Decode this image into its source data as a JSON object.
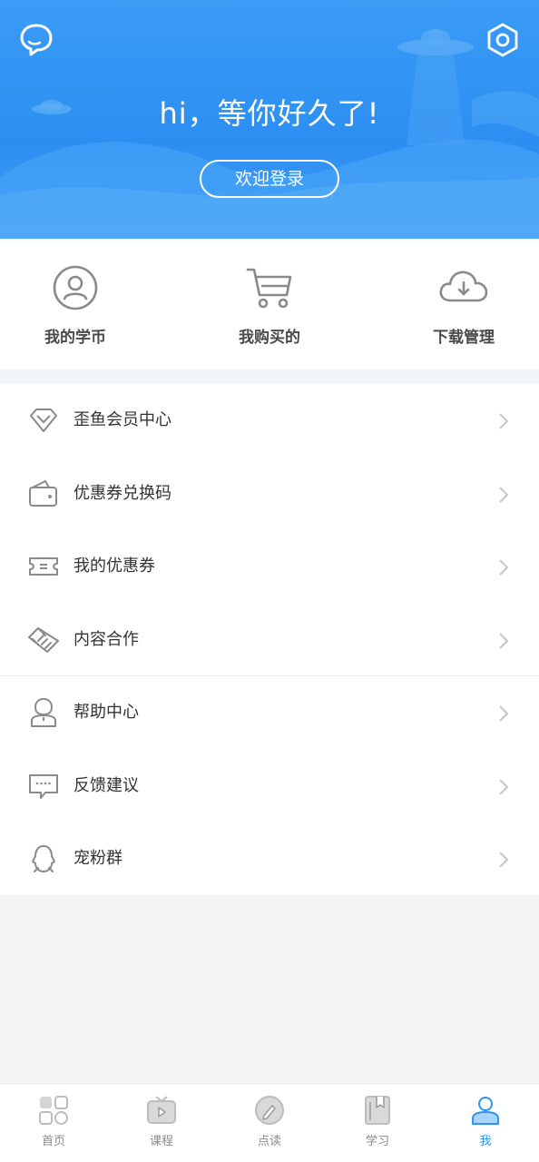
{
  "header": {
    "greeting": "hi，等你好久了!",
    "login_label": "欢迎登录"
  },
  "quick_actions": [
    {
      "label": "我的学币",
      "icon": "user-circle-icon"
    },
    {
      "label": "我购买的",
      "icon": "shopping-cart-icon"
    },
    {
      "label": "下载管理",
      "icon": "cloud-download-icon"
    }
  ],
  "menu_group1": [
    {
      "label": "歪鱼会员中心",
      "icon": "diamond-icon"
    },
    {
      "label": "优惠券兑换码",
      "icon": "wallet-icon"
    },
    {
      "label": "我的优惠券",
      "icon": "ticket-icon"
    },
    {
      "label": "内容合作",
      "icon": "handshake-icon"
    }
  ],
  "menu_group2": [
    {
      "label": "帮助中心",
      "icon": "help-person-icon"
    },
    {
      "label": "反馈建议",
      "icon": "feedback-chat-icon"
    },
    {
      "label": "宠粉群",
      "icon": "group-chat-icon"
    }
  ],
  "tabs": [
    {
      "label": "首页",
      "icon": "home-grid-icon"
    },
    {
      "label": "课程",
      "icon": "tv-play-icon"
    },
    {
      "label": "点读",
      "icon": "pen-read-icon"
    },
    {
      "label": "学习",
      "icon": "book-study-icon"
    },
    {
      "label": "我",
      "icon": "profile-icon",
      "active": true
    }
  ],
  "colors": {
    "accent": "#2f95ef",
    "header_top": "#3a9cf5",
    "text_primary": "#333333",
    "icon_gray": "#8a8a8a"
  }
}
